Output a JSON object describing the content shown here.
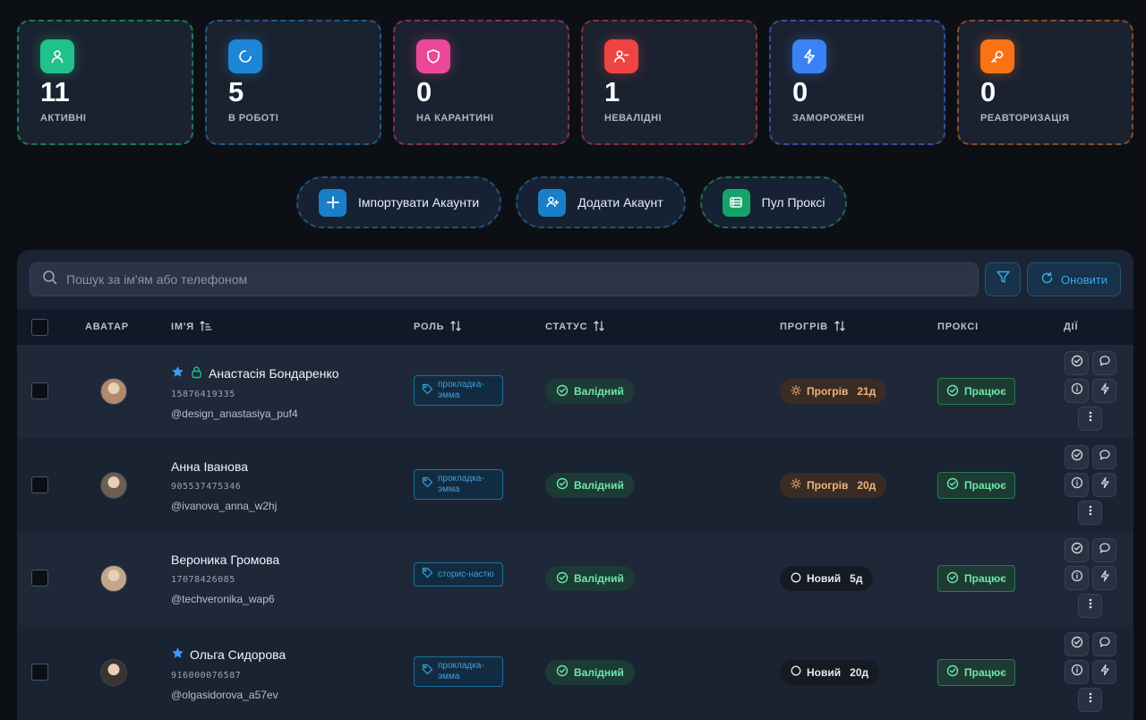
{
  "stats": [
    {
      "value": "11",
      "label": "АКТИВНІ",
      "color": "#22c08a",
      "border": "#1f7a5a",
      "icon": "user-icon"
    },
    {
      "value": "5",
      "label": "В РОБОТІ",
      "color": "#1e86d6",
      "border": "#1f5b8c",
      "icon": "spinner-icon"
    },
    {
      "value": "0",
      "label": "НА КАРАНТИНІ",
      "color": "#ec4899",
      "border": "#8a2d60",
      "icon": "shield-icon"
    },
    {
      "value": "1",
      "label": "НЕВАЛІДНІ",
      "color": "#ef4444",
      "border": "#8a2f33",
      "icon": "user-x-icon"
    },
    {
      "value": "0",
      "label": "ЗАМОРОЖЕНІ",
      "color": "#3b82f6",
      "border": "#3a4e9a",
      "icon": "bolt-icon"
    },
    {
      "value": "0",
      "label": "РЕАВТОРИЗАЦІЯ",
      "color": "#f97316",
      "border": "#8a4d26",
      "icon": "key-icon"
    }
  ],
  "actions": {
    "import_label": "Імпортувати Акаунти",
    "add_label": "Додати Акаунт",
    "proxy_label": "Пул Проксі"
  },
  "search": {
    "placeholder": "Пошук за ім'ям або телефоном",
    "refresh_label": "Оновити"
  },
  "table": {
    "headers": {
      "avatar": "АВАТАР",
      "name": "ІМ'Я",
      "role": "РОЛЬ",
      "status": "СТАТУС",
      "warmup": "ПРОГРІВ",
      "proxy": "ПРОКСІ",
      "actions": "ДІЇ"
    },
    "rows": [
      {
        "name": "Анастасія Бондаренко",
        "starred": true,
        "locked": true,
        "phone": "15876419335",
        "handle": "@design_anastasiya_puf4",
        "role": "прокладка-эмма",
        "status": "Валідний",
        "warmup": "Прогрів",
        "warmup_kind": "warm",
        "days": "21д",
        "proxy": "Працює",
        "avatar_bg": "#b08a6a"
      },
      {
        "name": "Анна Іванова",
        "starred": false,
        "locked": false,
        "phone": "905537475346",
        "handle": "@ivanova_anna_w2hj",
        "role": "прокладка-эмма",
        "status": "Валідний",
        "warmup": "Прогрів",
        "warmup_kind": "warm",
        "days": "20д",
        "proxy": "Працює",
        "avatar_bg": "#6b5f52"
      },
      {
        "name": "Вероника Громова",
        "starred": false,
        "locked": false,
        "phone": "17078426085",
        "handle": "@techveronika_wap6",
        "role": "сторис-настю",
        "status": "Валідний",
        "warmup": "Новий",
        "warmup_kind": "new",
        "days": "5д",
        "proxy": "Працює",
        "avatar_bg": "#c2a88a"
      },
      {
        "name": "Ольга Сидорова",
        "starred": true,
        "locked": false,
        "phone": "916000076587",
        "handle": "@olgasidorova_a57ev",
        "role": "прокладка-эмма",
        "status": "Валідний",
        "warmup": "Новий",
        "warmup_kind": "new",
        "days": "20д",
        "proxy": "Працює",
        "avatar_bg": "#3b3330"
      }
    ]
  }
}
